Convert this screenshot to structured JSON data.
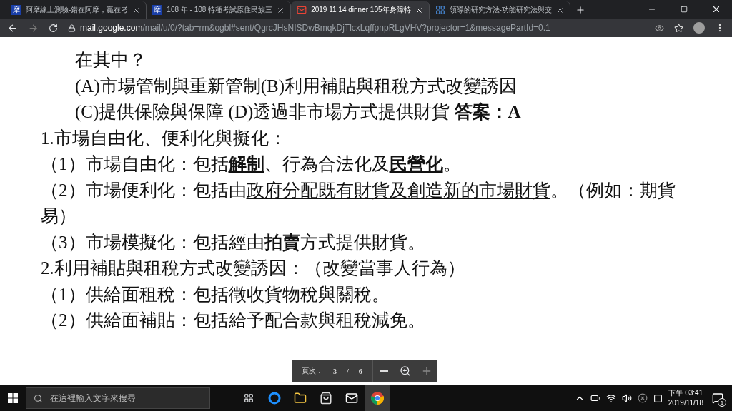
{
  "tabs": [
    {
      "title": "阿摩線上測驗-錯在阿摩，贏在考",
      "kind": "text",
      "favicon_text": "摩",
      "selected": false
    },
    {
      "title": "108 年 - 108 特種考試原住民族三",
      "kind": "text",
      "favicon_text": "摩",
      "selected": false
    },
    {
      "title": "2019 11 14 dinner 105年身障特",
      "kind": "mail",
      "selected": true
    },
    {
      "title": "領導的研究方法-功能研究法與交",
      "kind": "doc",
      "selected": false
    }
  ],
  "address": {
    "host": "mail.google.com",
    "path": "/mail/u/0/?tab=rm&ogbl#sent/QgrcJHsNISDwBmqkDjTlcxLqffpnpRLgVHV?projector=1&messagePartId=0.1"
  },
  "document": {
    "lines": [
      {
        "kind": "question",
        "segments": [
          {
            "text": "在其中？",
            "bold": false,
            "underline": false
          }
        ]
      },
      {
        "kind": "question",
        "segments": [
          {
            "text": "(A)市場管制與重新管制(B)利用補貼與租稅方式改變誘因",
            "bold": false,
            "underline": false
          }
        ]
      },
      {
        "kind": "question",
        "segments": [
          {
            "text": "(C)提供保險與保障  (D)透過非市場方式提供財貨  ",
            "bold": false,
            "underline": false
          },
          {
            "text": "答案：A",
            "bold": true,
            "underline": false
          }
        ]
      },
      {
        "kind": "item",
        "segments": [
          {
            "text": "1.市場自由化、便利化與擬化：",
            "bold": false,
            "underline": false
          }
        ]
      },
      {
        "kind": "item",
        "segments": [
          {
            "text": "（1）市場自由化：包括",
            "bold": false,
            "underline": false
          },
          {
            "text": "解制",
            "bold": true,
            "underline": true
          },
          {
            "text": "、行為合法化及",
            "bold": false,
            "underline": false
          },
          {
            "text": "民營化",
            "bold": true,
            "underline": true
          },
          {
            "text": "。",
            "bold": false,
            "underline": false
          }
        ]
      },
      {
        "kind": "item",
        "segments": [
          {
            "text": "（2）市場便利化：包括由",
            "bold": false,
            "underline": false
          },
          {
            "text": "政府分配既有財貨及創造新的市場財貨",
            "bold": false,
            "underline": true
          },
          {
            "text": "。（例如：期貨",
            "bold": false,
            "underline": false
          }
        ]
      },
      {
        "kind": "item",
        "segments": [
          {
            "text": "易）",
            "bold": false,
            "underline": false
          }
        ]
      },
      {
        "kind": "item",
        "segments": [
          {
            "text": "（3）市場模擬化：包括經由",
            "bold": false,
            "underline": false
          },
          {
            "text": "拍賣",
            "bold": true,
            "underline": false
          },
          {
            "text": "方式提供財貨。",
            "bold": false,
            "underline": false
          }
        ]
      },
      {
        "kind": "item",
        "segments": [
          {
            "text": "2.利用補貼與租稅方式改變誘因：（改變當事人行為）",
            "bold": false,
            "underline": false
          }
        ]
      },
      {
        "kind": "item",
        "segments": [
          {
            "text": "（1）供給面租稅：包括徵收貨物稅與關稅。",
            "bold": false,
            "underline": false
          }
        ]
      },
      {
        "kind": "item",
        "segments": [
          {
            "text": "（2）供給面補貼：包括給予配合款與租稅減免。",
            "bold": false,
            "underline": false
          }
        ]
      }
    ]
  },
  "pager": {
    "label": "頁次：",
    "current": "3",
    "separator": "/",
    "total": "6"
  },
  "taskbar": {
    "search_placeholder": "在這裡輸入文字來搜尋",
    "time": "下午 03:41",
    "date": "2019/11/18",
    "notification_count": "1"
  }
}
